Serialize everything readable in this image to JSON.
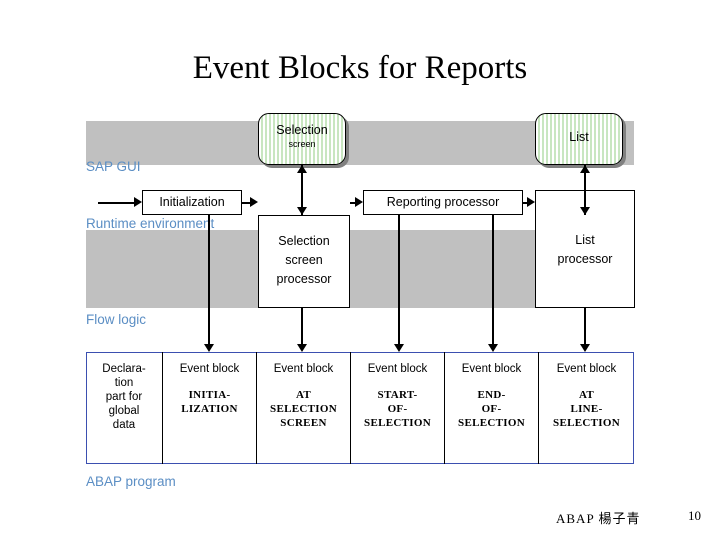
{
  "title": "Event Blocks for Reports",
  "labels": {
    "sap_gui": "SAP GUI",
    "runtime_environment": "Runtime environment",
    "flow_logic": "Flow logic",
    "abap_program": "ABAP program"
  },
  "screens": {
    "selection_screen": {
      "line1": "Selection",
      "line2": "screen"
    },
    "list": {
      "line1": "List",
      "line2": ""
    }
  },
  "processors": {
    "initialization": "Initialization",
    "reporting_processor": "Reporting processor",
    "selection_screen_processor": {
      "line1": "Selection",
      "line2": "screen",
      "line3": "processor"
    },
    "list_processor": {
      "line1": "List",
      "line2": "processor"
    }
  },
  "program_cells": [
    {
      "header": "Declara-\ntion\npart for\nglobal\ndata",
      "code": ""
    },
    {
      "header": "Event block",
      "code": "INITIA-\nLIZATION"
    },
    {
      "header": "Event block",
      "code": "AT\nSELECTION\nSCREEN"
    },
    {
      "header": "Event block",
      "code": "START-\nOF-\nSELECTION"
    },
    {
      "header": "Event block",
      "code": "END-\nOF-\nSELECTION"
    },
    {
      "header": "Event block",
      "code": "AT\nLINE-\nSELECTION"
    }
  ],
  "footer": {
    "author": "ABAP 楊子青",
    "page": "10"
  },
  "colors": {
    "band": "#c0c0c0",
    "label_blue": "#5b8ec4",
    "program_border": "#3b4fb0"
  }
}
